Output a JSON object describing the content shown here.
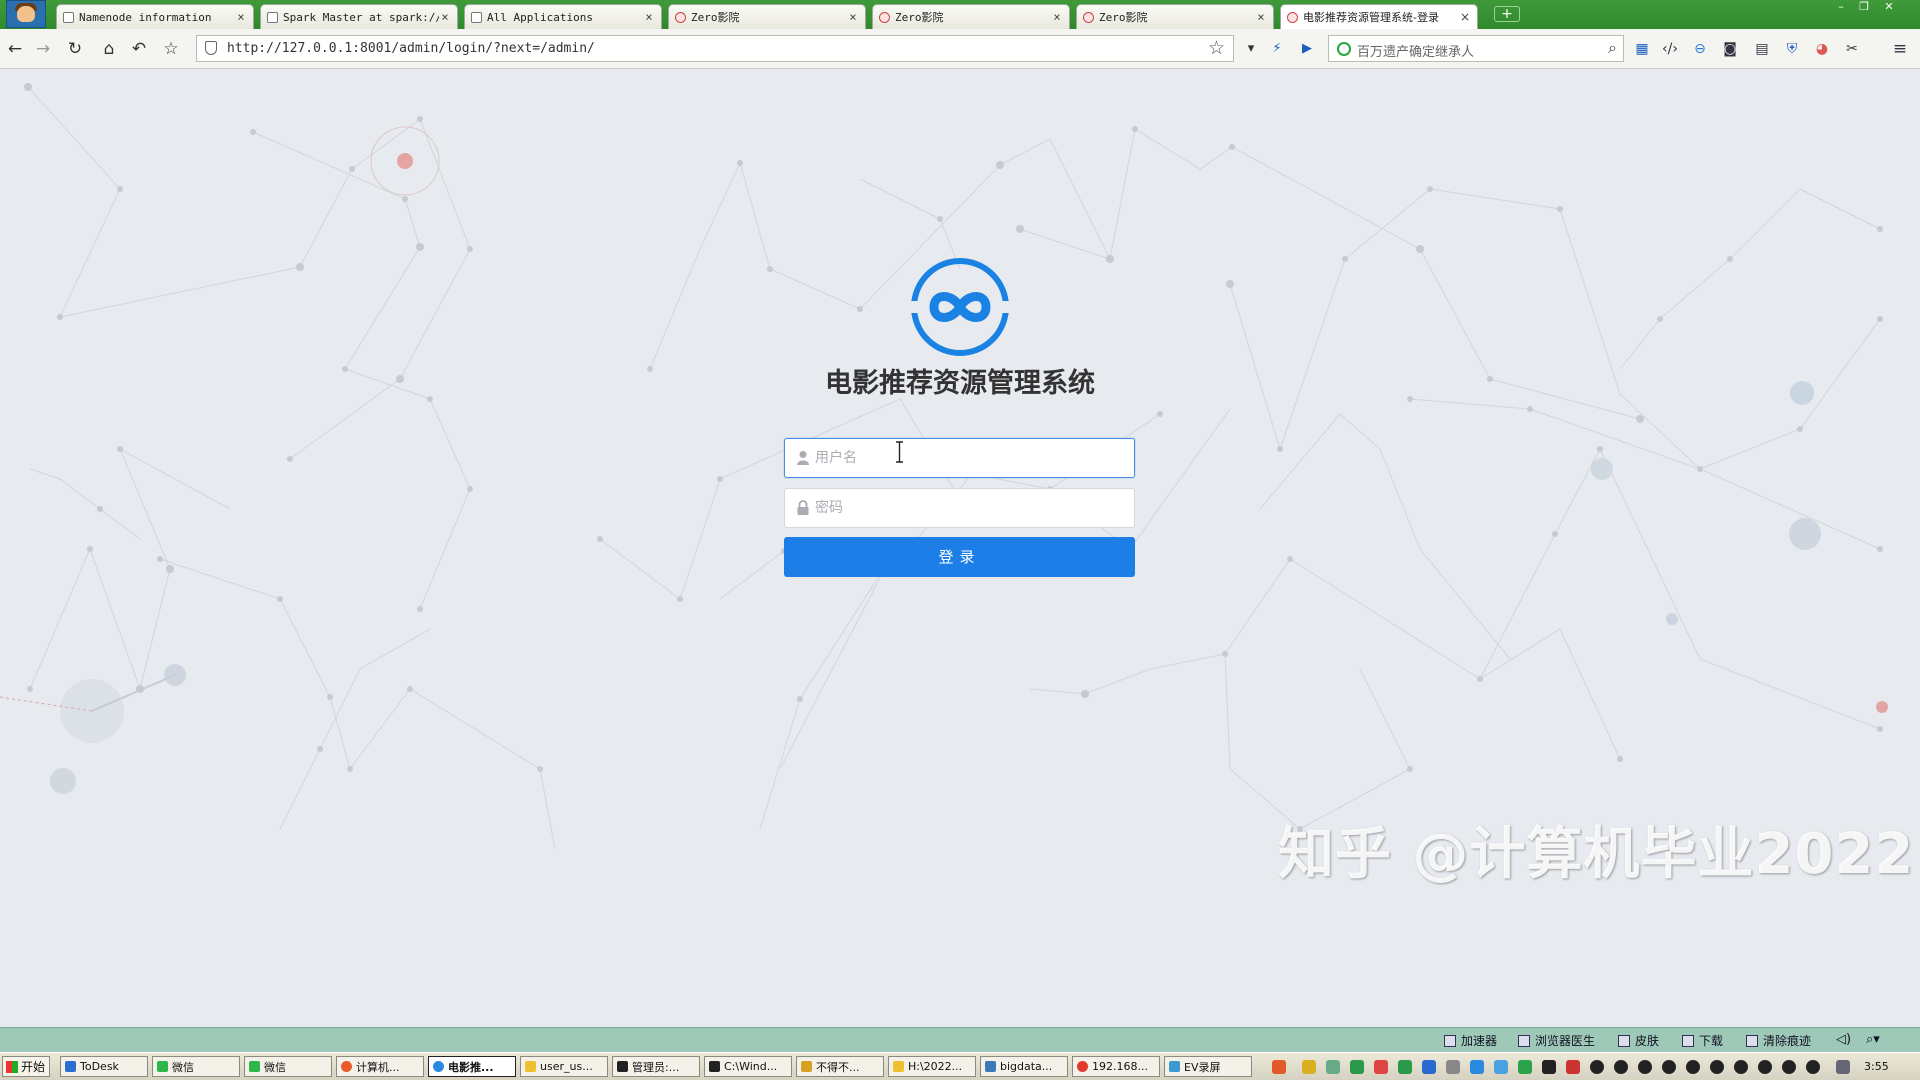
{
  "browser": {
    "tabs": [
      {
        "title": "Namenode information",
        "active": false
      },
      {
        "title": "Spark Master at spark://",
        "active": false
      },
      {
        "title": "All Applications",
        "active": false
      },
      {
        "title": "Zero影院",
        "active": false
      },
      {
        "title": "Zero影院",
        "active": false
      },
      {
        "title": "Zero影院",
        "active": false
      },
      {
        "title": "电影推荐资源管理系统-登录",
        "active": true
      }
    ],
    "new_tab_label": "+",
    "url": "http://127.0.0.1:8001/admin/login/?next=/admin/",
    "search_placeholder": "百万遗产确定继承人"
  },
  "login": {
    "system_title": "电影推荐资源管理系统",
    "username_placeholder": "用户名",
    "password_placeholder": "密码",
    "submit_label": "登录"
  },
  "watermark": "知乎 @计算机毕业2022",
  "statusbar": {
    "items": [
      "加速器",
      "浏览器医生",
      "皮肤",
      "下载",
      "清除痕迹"
    ]
  },
  "taskbar": {
    "start_label": "开始",
    "tasks": [
      {
        "label": "ToDesk",
        "active": false
      },
      {
        "label": "微信",
        "active": false
      },
      {
        "label": "微信",
        "active": false
      },
      {
        "label": "计算机...",
        "active": false
      },
      {
        "label": "电影推...",
        "active": true
      },
      {
        "label": "user_us...",
        "active": false
      },
      {
        "label": "管理员:...",
        "active": false
      },
      {
        "label": "C:\\Wind...",
        "active": false
      },
      {
        "label": "不得不...",
        "active": false
      },
      {
        "label": "H:\\2022...",
        "active": false
      },
      {
        "label": "bigdata...",
        "active": false
      },
      {
        "label": "192.168...",
        "active": false
      },
      {
        "label": "EV录屏",
        "active": false
      }
    ],
    "clock": "3:55"
  },
  "colors": {
    "tabbar_green": "#2f8a2c",
    "primary_blue": "#1d7ee8",
    "page_bg": "#e7eaef",
    "statusbar": "#9ec9b9"
  }
}
